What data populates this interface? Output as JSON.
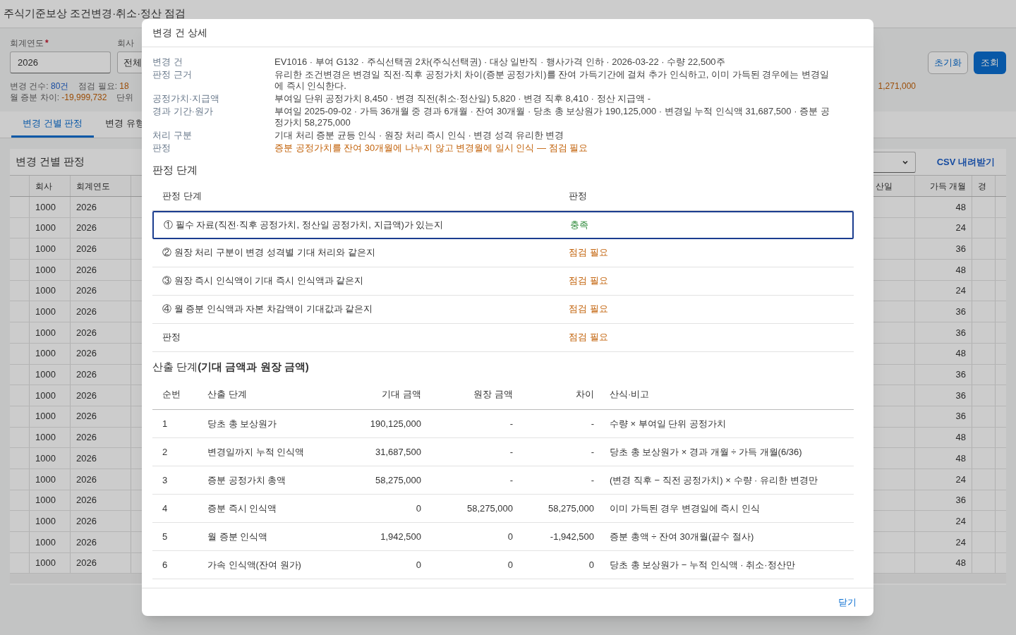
{
  "page": {
    "title": "주식기준보상 조건변경·취소·정산 점검"
  },
  "filters": {
    "fiscal_year": {
      "label": "회계연도",
      "required_mark": "*",
      "value": "2026"
    },
    "company": {
      "label": "회사",
      "value": "전체"
    }
  },
  "buttons": [
    {
      "label": "초기화",
      "kind": "secondary"
    },
    {
      "label": "조회",
      "kind": "primary"
    }
  ],
  "summary": [
    [
      {
        "label": "변경 건수:",
        "value": "80건",
        "kind": "info"
      },
      {
        "label": "점검 필요:",
        "value": "18",
        "kind": "warning"
      }
    ],
    [
      {
        "label": "월 증분 차이:",
        "value": "-19,999,732",
        "kind": "warning"
      },
      {
        "label": "단위"
      }
    ]
  ],
  "summary_right": {
    "value": "1,271,000",
    "kind": "warning"
  },
  "tabs": [
    {
      "label": "변경 건별 판정",
      "selected": true
    },
    {
      "label": "변경 유형",
      "selected": false
    }
  ],
  "card": {
    "title": "변경 건별 판정",
    "csv_link": "CSV 내려받기",
    "columns_left": [
      "회사",
      "회계연도"
    ],
    "columns_right": [
      "산일",
      "가득 개월",
      "경"
    ],
    "rows": [
      {
        "company": "1000",
        "year": "2026",
        "months": "48"
      },
      {
        "company": "1000",
        "year": "2026",
        "months": "24"
      },
      {
        "company": "1000",
        "year": "2026",
        "months": "36"
      },
      {
        "company": "1000",
        "year": "2026",
        "months": "48"
      },
      {
        "company": "1000",
        "year": "2026",
        "months": "24"
      },
      {
        "company": "1000",
        "year": "2026",
        "months": "36"
      },
      {
        "company": "1000",
        "year": "2026",
        "months": "36"
      },
      {
        "company": "1000",
        "year": "2026",
        "months": "48"
      },
      {
        "company": "1000",
        "year": "2026",
        "months": "36"
      },
      {
        "company": "1000",
        "year": "2026",
        "months": "36"
      },
      {
        "company": "1000",
        "year": "2026",
        "months": "36"
      },
      {
        "company": "1000",
        "year": "2026",
        "months": "48"
      },
      {
        "company": "1000",
        "year": "2026",
        "months": "48"
      },
      {
        "company": "1000",
        "year": "2026",
        "months": "24"
      },
      {
        "company": "1000",
        "year": "2026",
        "months": "36"
      },
      {
        "company": "1000",
        "year": "2026",
        "months": "24"
      },
      {
        "company": "1000",
        "year": "2026",
        "months": "24"
      },
      {
        "company": "1000",
        "year": "2026",
        "months": "48"
      }
    ]
  },
  "detail": {
    "title": "변경 건 상세",
    "fields": [
      {
        "label": "변경 건",
        "value": "EV1016 · 부여 G132 · 주식선택권 2차(주식선택권) · 대상 일반직 · 행사가격 인하 · 2026-03-22 · 수량 22,500주",
        "kind": "normal"
      },
      {
        "label": "판정 근거",
        "value": "유리한 조건변경은 변경일 직전·직후 공정가치 차이(증분 공정가치)를 잔여 가득기간에 걸쳐 추가 인식하고, 이미 가득된 경우에는 변경일에 즉시 인식한다.",
        "kind": "normal"
      },
      {
        "label": "공정가치·지급액",
        "value": "부여일 단위 공정가치 8,450 · 변경 직전(취소·정산일) 5,820 · 변경 직후 8,410 · 정산 지급액 -",
        "kind": "normal"
      },
      {
        "label": "경과 기간·원가",
        "value": "부여일 2025-09-02 · 가득 36개월 중 경과 6개월 · 잔여 30개월 · 당초 총 보상원가 190,125,000 · 변경일 누적 인식액 31,687,500 · 증분 공정가치 58,275,000",
        "kind": "normal"
      },
      {
        "label": "처리 구분",
        "value": "기대 처리 증분 균등 인식 · 원장 처리 즉시 인식 · 변경 성격 유리한 변경",
        "kind": "normal"
      },
      {
        "label": "판정",
        "value": "증분 공정가치를 잔여 30개월에 나누지 않고 변경월에 일시 인식 — 점검 필요",
        "kind": "warning"
      }
    ],
    "check_section": {
      "title": "판정 단계",
      "columns": [
        "판정 단계",
        "판정"
      ],
      "rows": [
        {
          "step": "① 필수 자료(직전·직후 공정가치, 정산일 공정가치, 지급액)가 있는지",
          "result": "충족",
          "kind": "pass",
          "selected": true
        },
        {
          "step": "② 원장 처리 구분이 변경 성격별 기대 처리와 같은지",
          "result": "점검 필요",
          "kind": "fail",
          "selected": false
        },
        {
          "step": "③ 원장 즉시 인식액이 기대 즉시 인식액과 같은지",
          "result": "점검 필요",
          "kind": "fail",
          "selected": false
        },
        {
          "step": "④ 월 증분 인식액과 자본 차감액이 기대값과 같은지",
          "result": "점검 필요",
          "kind": "fail",
          "selected": false
        },
        {
          "step": "판정",
          "result": "점검 필요",
          "kind": "fail",
          "selected": false
        }
      ]
    },
    "calc_section": {
      "title": "산출 단계**(기대 금액과 원장 금액)**",
      "columns": [
        "순번",
        "산출 단계",
        "기대 금액",
        "원장 금액",
        "차이",
        "산식·비고"
      ],
      "rows": [
        [
          "1",
          "당초 총 보상원가",
          "190,125,000",
          "-",
          "-",
          "수량 × 부여일 단위 공정가치"
        ],
        [
          "2",
          "변경일까지 누적 인식액",
          "31,687,500",
          "-",
          "-",
          "당초 총 보상원가 × 경과 개월 ÷ 가득 개월(6/36)"
        ],
        [
          "3",
          "증분 공정가치 총액",
          "58,275,000",
          "-",
          "-",
          "(변경 직후 − 직전 공정가치) × 수량 · 유리한 변경만"
        ],
        [
          "4",
          "증분 즉시 인식액",
          "0",
          "58,275,000",
          "58,275,000",
          "이미 가득된 경우 변경일에 즉시 인식"
        ],
        [
          "5",
          "월 증분 인식액",
          "1,942,500",
          "0",
          "-1,942,500",
          "증분 총액 ÷ 잔여 30개월(끝수 절사)"
        ],
        [
          "6",
          "가속 인식액(잔여 원가)",
          "0",
          "0",
          "0",
          "당초 총 보상원가 − 누적 인식액 · 취소·정산만"
        ]
      ]
    },
    "close": "닫기"
  }
}
